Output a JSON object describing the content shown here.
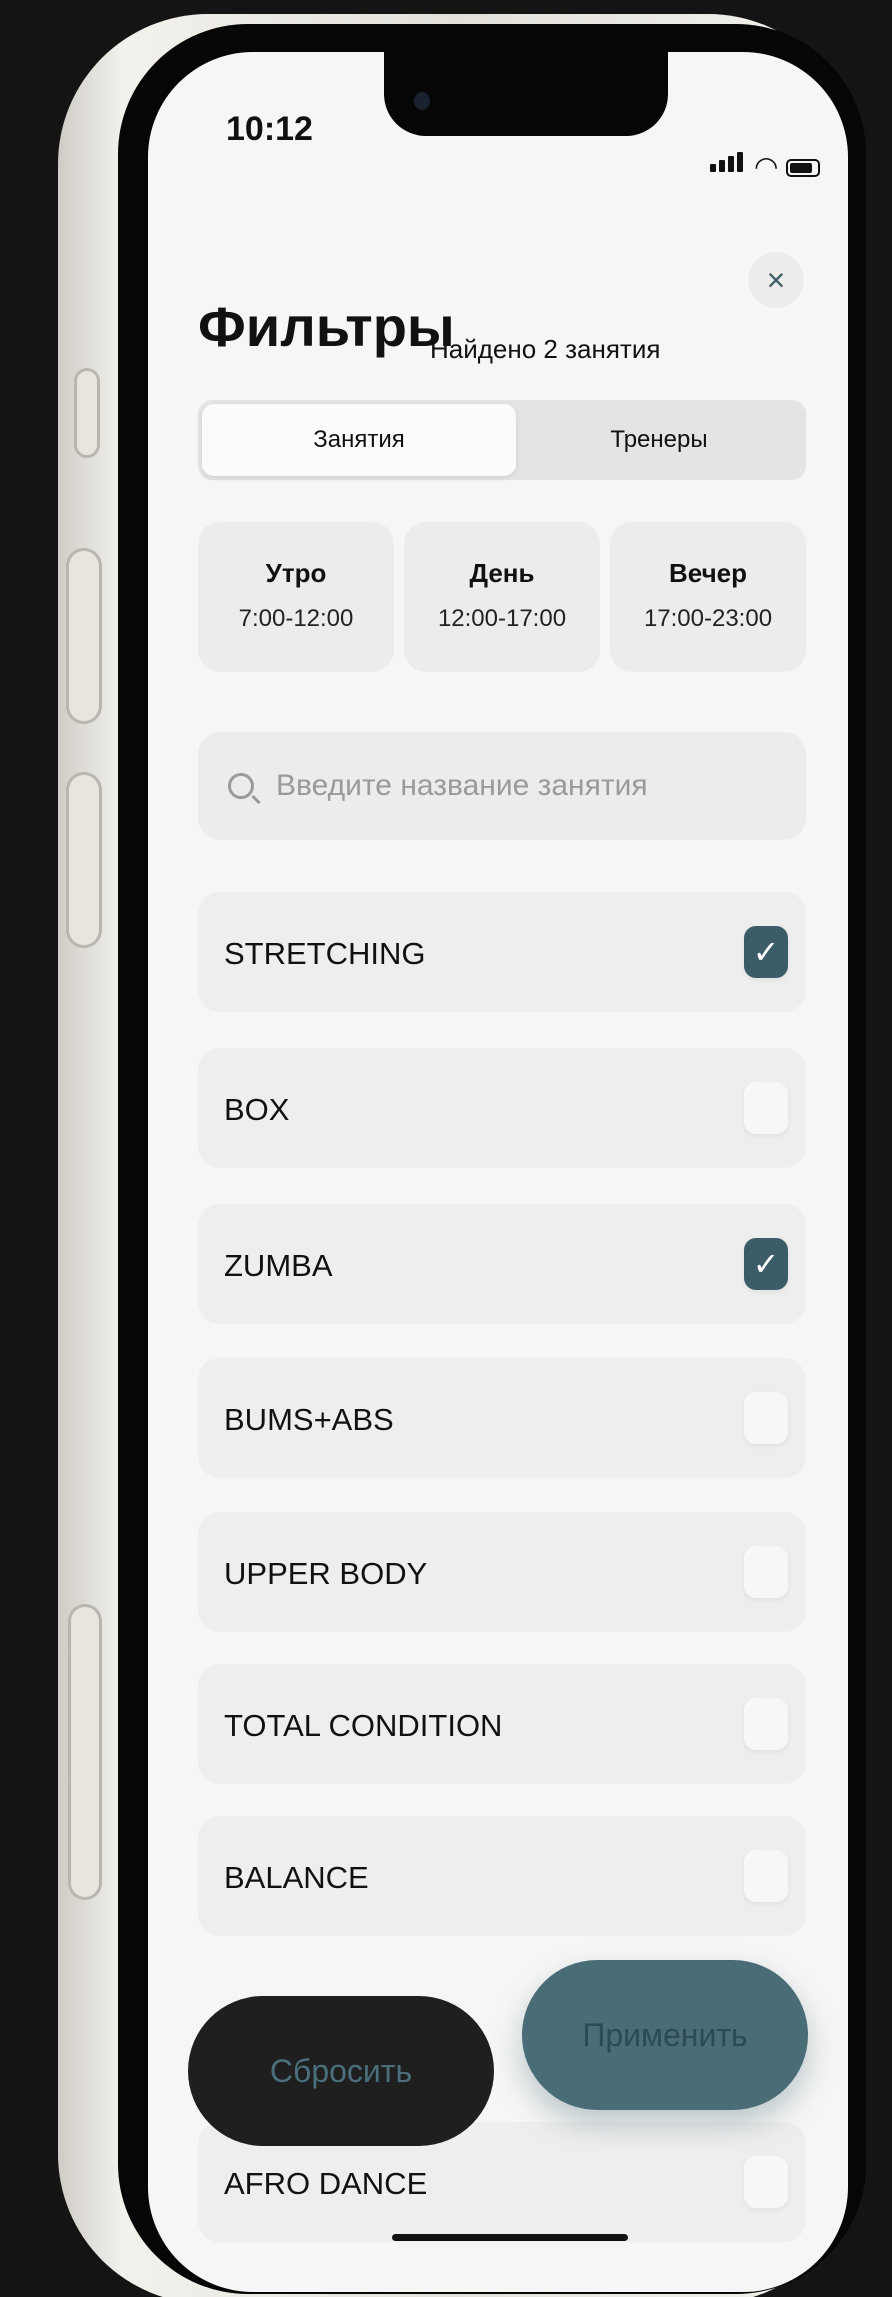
{
  "status_bar": {
    "time": "10:12"
  },
  "header": {
    "title": "Фильтры",
    "found_text": "Найдено 2 занятия",
    "close_label": "×"
  },
  "segments": [
    {
      "label": "Занятия",
      "active": true
    },
    {
      "label": "Тренеры",
      "active": false
    }
  ],
  "time_slots": [
    {
      "name": "Утро",
      "range": "7:00-12:00"
    },
    {
      "name": "День",
      "range": "12:00-17:00"
    },
    {
      "name": "Вечер",
      "range": "17:00-23:00"
    }
  ],
  "search": {
    "placeholder": "Введите название занятия",
    "value": ""
  },
  "classes": [
    {
      "label": "STRETCHING",
      "checked": true
    },
    {
      "label": "BOX",
      "checked": false
    },
    {
      "label": "ZUMBA",
      "checked": true
    },
    {
      "label": "BUMS+ABS",
      "checked": false
    },
    {
      "label": "UPPER BODY",
      "checked": false
    },
    {
      "label": "TOTAL CONDITION",
      "checked": false
    },
    {
      "label": "BALANCE",
      "checked": false
    },
    {
      "label": "AFRO DANCE",
      "checked": false
    }
  ],
  "actions": {
    "reset_label": "Сбросить",
    "apply_label": "Применить"
  },
  "colors": {
    "accent": "#3c5d68",
    "dark_button": "#1f1f1f",
    "screen_bg": "#f6f6f6"
  },
  "icons": {
    "close": "close-icon",
    "search": "search-icon",
    "check": "checkmark-icon"
  }
}
